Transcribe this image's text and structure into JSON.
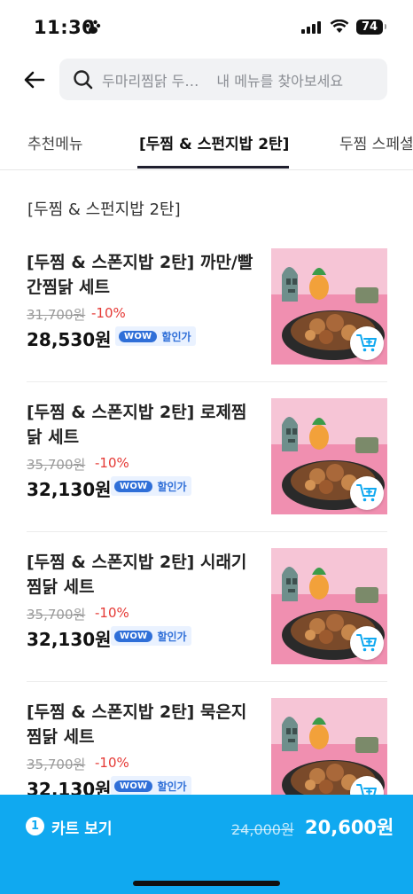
{
  "status": {
    "time": "11:30",
    "battery": "74"
  },
  "search": {
    "placeholder_main": "두마리찜닭 두…",
    "placeholder_hint": "내 메뉴를 찾아보세요"
  },
  "tabs": [
    {
      "label": "추천메뉴",
      "active": false
    },
    {
      "label": "[두찜 & 스펀지밥 2탄]",
      "active": true
    },
    {
      "label": "두찜 스페셜",
      "active": false
    }
  ],
  "section_title": "[두찜 & 스펀지밥 2탄]",
  "items": [
    {
      "name": "[두찜 & 스폰지밥 2탄] 까만/빨간찜닭 세트",
      "original_price": "31,700원",
      "discount": "-10%",
      "price": "28,530원",
      "wow_badge": "WOW",
      "wow_text": "할인가"
    },
    {
      "name": "[두찜 & 스폰지밥 2탄] 로제찜닭 세트",
      "original_price": "35,700원",
      "discount": "-10%",
      "price": "32,130원",
      "wow_badge": "WOW",
      "wow_text": "할인가"
    },
    {
      "name": "[두찜 & 스폰지밥 2탄] 시래기찜닭 세트",
      "original_price": "35,700원",
      "discount": "-10%",
      "price": "32,130원",
      "wow_badge": "WOW",
      "wow_text": "할인가"
    },
    {
      "name": "[두찜 & 스폰지밥 2탄] 묵은지찜닭 세트",
      "original_price": "35,700원",
      "discount": "-10%",
      "price": "32,130원",
      "wow_badge": "WOW",
      "wow_text": "할인가"
    }
  ],
  "cart": {
    "count": "1",
    "label": "카트 보기",
    "original_total": "24,000원",
    "total": "20,600원"
  },
  "colors": {
    "accent": "#10a9f0",
    "discount": "#e53935",
    "wow": "#2f6fd8",
    "thumb_bg": "#f08fb0"
  }
}
